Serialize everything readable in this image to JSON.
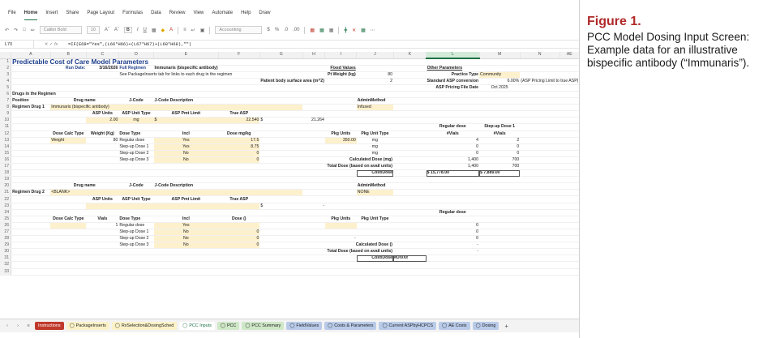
{
  "menu": [
    "File",
    "Home",
    "Insert",
    "Share",
    "Page Layout",
    "Formulas",
    "Data",
    "Review",
    "View",
    "Automate",
    "Help",
    "Draw"
  ],
  "menu_active": 1,
  "toolbar": {
    "font": "Calibri Bold",
    "size": "10",
    "numfmt": "Accounting"
  },
  "namebox": "L70",
  "formula": "=IF(E68=\"Yes\",(L66*H66)+(L67*H67)+(L68*H68),\"\")",
  "columns": [
    "",
    "A",
    "B",
    "C",
    "D",
    "E",
    "F",
    "G",
    "H",
    "I",
    "J",
    "K",
    "L",
    "M",
    "N",
    "AE"
  ],
  "rows": [
    {
      "n": "1",
      "cells": [
        {
          "t": "Predictable Cost of Care Model Parameters",
          "cls": "title",
          "span": 6
        }
      ]
    },
    {
      "n": "2",
      "cells": [
        {
          "t": "Run Date:",
          "col": 1,
          "cls": "blue r"
        },
        {
          "t": "3/16/2026",
          "col": 2,
          "cls": "r b"
        },
        {
          "t": "Full Regimen",
          "col": 3,
          "cls": "blue"
        },
        {
          "t": "Immunaris (bispecific antibody)",
          "col": 4,
          "cls": "b",
          "span": 2
        },
        {
          "t": "Fixed Values",
          "col": 8,
          "cls": "b ul r"
        },
        {
          "t": "Other Parameters",
          "col": 11,
          "cls": "b ul"
        }
      ]
    },
    {
      "n": "3",
      "cells": [
        {
          "t": "See PackageInserts tab for links to each drug in the regimen",
          "col": 3,
          "span": 4
        },
        {
          "t": "Pt Weight (kg)",
          "col": 8,
          "cls": "r b"
        },
        {
          "t": "80",
          "col": 9,
          "cls": "r"
        },
        {
          "t": "Practice Type",
          "col": 11,
          "cls": "r b"
        },
        {
          "t": "Community",
          "col": 12,
          "cls": "yl"
        }
      ]
    },
    {
      "n": "4",
      "cells": [
        {
          "t": "Patient body surface area (m^2)",
          "col": 6,
          "cls": "r b",
          "span": 2
        },
        {
          "t": "2",
          "col": 9,
          "cls": "r"
        },
        {
          "t": "Standard ASP conversion",
          "col": 11,
          "cls": "r b"
        },
        {
          "t": "6.00%",
          "col": 12,
          "cls": "r"
        },
        {
          "t": "(ASP Pricing Limit to true ASP)",
          "col": 13,
          "span": 3
        }
      ]
    },
    {
      "n": "5",
      "cells": [
        {
          "t": "ASP Pricing File Date",
          "col": 11,
          "cls": "r b"
        },
        {
          "t": "Oct 2025",
          "col": 12,
          "cls": "c"
        }
      ]
    },
    {
      "n": "6",
      "cells": [
        {
          "t": "Drugs in the Regimen",
          "col": 0,
          "cls": "b",
          "span": 2
        }
      ]
    },
    {
      "n": "7",
      "cells": [
        {
          "t": "Position",
          "col": 0,
          "cls": "b"
        },
        {
          "t": "Drug name",
          "col": 1,
          "cls": "b c",
          "span": 2
        },
        {
          "t": "J-Code",
          "col": 3,
          "cls": "b c"
        },
        {
          "t": "J-Code Description",
          "col": 4,
          "cls": "b"
        },
        {
          "t": "AdminMethod",
          "col": 9,
          "cls": "b"
        }
      ]
    },
    {
      "n": "8",
      "cells": [
        {
          "t": "Regimen Drug 1",
          "col": 0,
          "cls": "b"
        },
        {
          "t": "Immunaris (bispecific antibody)",
          "col": 1,
          "cls": "yl",
          "span": 2
        },
        {
          "t": "",
          "col": 3,
          "cls": "yl"
        },
        {
          "t": "",
          "col": 4,
          "cls": "yl"
        },
        {
          "t": "",
          "col": 5,
          "cls": "yl"
        },
        {
          "t": "",
          "col": 6,
          "cls": "yl"
        },
        {
          "t": "Infused",
          "col": 9,
          "cls": "yl"
        }
      ]
    },
    {
      "n": "9",
      "cells": [
        {
          "t": "ASP Units",
          "col": 2,
          "cls": "b c"
        },
        {
          "t": "ASP Unit Type",
          "col": 3,
          "cls": "b c"
        },
        {
          "t": "ASP Pmt Limit",
          "col": 4,
          "cls": "b c"
        },
        {
          "t": "True ASP",
          "col": 5,
          "cls": "b c"
        }
      ]
    },
    {
      "n": "10",
      "cells": [
        {
          "t": "2.00",
          "col": 2,
          "cls": "yl r"
        },
        {
          "t": "mg",
          "col": 3,
          "cls": "yl c"
        },
        {
          "t": "$",
          "col": 4,
          "cls": "yl"
        },
        {
          "t": "22.540",
          "col": 5,
          "cls": "yl r"
        },
        {
          "t": "$",
          "col": 6
        },
        {
          "t": "21.264",
          "col": 7,
          "cls": "r"
        }
      ]
    },
    {
      "n": "11",
      "cells": [
        {
          "t": "Regular dose",
          "col": 11,
          "cls": "b c"
        },
        {
          "t": "Step-up Dose 1",
          "col": 12,
          "cls": "b c"
        }
      ]
    },
    {
      "n": "12",
      "cells": [
        {
          "t": "Dose Calc Type",
          "col": 1,
          "cls": "b c"
        },
        {
          "t": "Weight (Kg)",
          "col": 2,
          "cls": "b c"
        },
        {
          "t": "Dose Type",
          "col": 3,
          "cls": "b"
        },
        {
          "t": "Incl",
          "col": 4,
          "cls": "b c"
        },
        {
          "t": "Dose mg/kg",
          "col": 5,
          "cls": "b c"
        },
        {
          "t": "Pkg Units",
          "col": 8,
          "cls": "b c"
        },
        {
          "t": "Pkg Unit Type",
          "col": 9,
          "cls": "b c"
        },
        {
          "t": "#Vials",
          "col": 11,
          "cls": "b c"
        },
        {
          "t": "#Vials",
          "col": 12,
          "cls": "b c"
        }
      ]
    },
    {
      "n": "13",
      "cells": [
        {
          "t": "Weight",
          "col": 1,
          "cls": "yl"
        },
        {
          "t": "80",
          "col": 2,
          "cls": "r"
        },
        {
          "t": "Regular dose",
          "col": 3
        },
        {
          "t": "Yes",
          "col": 4,
          "cls": "yl c"
        },
        {
          "t": "17.5",
          "col": 5,
          "cls": "yl r"
        },
        {
          "t": "350.00",
          "col": 8,
          "cls": "yl r"
        },
        {
          "t": "mg",
          "col": 9,
          "cls": "c"
        },
        {
          "t": "4",
          "col": 11,
          "cls": "r"
        },
        {
          "t": "2",
          "col": 12,
          "cls": "r"
        }
      ]
    },
    {
      "n": "14",
      "cells": [
        {
          "t": "Step-up Dose 1",
          "col": 3
        },
        {
          "t": "Yes",
          "col": 4,
          "cls": "yl c"
        },
        {
          "t": "8.75",
          "col": 5,
          "cls": "yl r"
        },
        {
          "t": "mg",
          "col": 9,
          "cls": "c"
        },
        {
          "t": "0",
          "col": 11,
          "cls": "r"
        },
        {
          "t": "0",
          "col": 12,
          "cls": "r"
        }
      ]
    },
    {
      "n": "15",
      "cells": [
        {
          "t": "Step-up Dose 2",
          "col": 3
        },
        {
          "t": "No",
          "col": 4,
          "cls": "yl c"
        },
        {
          "t": "0",
          "col": 5,
          "cls": "yl r"
        },
        {
          "t": "mg",
          "col": 9,
          "cls": "c"
        },
        {
          "t": "0",
          "col": 11,
          "cls": "r"
        },
        {
          "t": "0",
          "col": 12,
          "cls": "r"
        }
      ]
    },
    {
      "n": "16",
      "cells": [
        {
          "t": "Step-up Dose 3",
          "col": 3
        },
        {
          "t": "No",
          "col": 4,
          "cls": "yl c"
        },
        {
          "t": "0",
          "col": 5,
          "cls": "yl r"
        },
        {
          "t": "Calculated Dose (mg)",
          "col": 8,
          "cls": "b r",
          "span": 2
        },
        {
          "t": "1,400",
          "col": 11,
          "cls": "r"
        },
        {
          "t": "700",
          "col": 12,
          "cls": "r"
        }
      ]
    },
    {
      "n": "17",
      "cells": [
        {
          "t": "Total Dose (based on avail units)",
          "col": 7,
          "cls": "b r",
          "span": 3
        },
        {
          "t": "1,400",
          "col": 11,
          "cls": "r"
        },
        {
          "t": "700",
          "col": 12,
          "cls": "r"
        }
      ]
    },
    {
      "n": "18",
      "cells": [
        {
          "t": "Cost/Dose",
          "col": 9,
          "cls": "b r bx"
        },
        {
          "t": "$  15,778.00",
          "col": 11,
          "cls": "b bx"
        },
        {
          "t": "$    7,889.00",
          "col": 12,
          "cls": "b bx"
        }
      ]
    },
    {
      "n": "19",
      "cells": []
    },
    {
      "n": "20",
      "cells": [
        {
          "t": "Drug name",
          "col": 1,
          "cls": "b c",
          "span": 2
        },
        {
          "t": "J-Code",
          "col": 3,
          "cls": "b c"
        },
        {
          "t": "J-Code Description",
          "col": 4,
          "cls": "b"
        },
        {
          "t": "AdminMethod",
          "col": 9,
          "cls": "b"
        }
      ]
    },
    {
      "n": "21",
      "cells": [
        {
          "t": "Regimen Drug 2",
          "col": 0,
          "cls": "b"
        },
        {
          "t": "<BLANK>",
          "col": 1,
          "cls": "yl",
          "span": 2
        },
        {
          "t": "",
          "col": 3,
          "cls": "yl"
        },
        {
          "t": "",
          "col": 4,
          "cls": "yl"
        },
        {
          "t": "",
          "col": 5,
          "cls": "yl"
        },
        {
          "t": "",
          "col": 6,
          "cls": "yl"
        },
        {
          "t": "NONE",
          "col": 9,
          "cls": "yl"
        }
      ]
    },
    {
      "n": "22",
      "cells": [
        {
          "t": "ASP Units",
          "col": 2,
          "cls": "b c"
        },
        {
          "t": "ASP Unit Type",
          "col": 3,
          "cls": "b c"
        },
        {
          "t": "ASP Pmt Limit",
          "col": 4,
          "cls": "b c"
        },
        {
          "t": "True ASP",
          "col": 5,
          "cls": "b c"
        }
      ]
    },
    {
      "n": "23",
      "cells": [
        {
          "t": "",
          "col": 2,
          "cls": "yl"
        },
        {
          "t": "",
          "col": 3,
          "cls": "yl"
        },
        {
          "t": "",
          "col": 4,
          "cls": "yl"
        },
        {
          "t": "",
          "col": 5,
          "cls": "yl"
        },
        {
          "t": "$",
          "col": 6
        },
        {
          "t": "-",
          "col": 7,
          "cls": "r"
        }
      ]
    },
    {
      "n": "24",
      "cells": [
        {
          "t": "Regular dose",
          "col": 11,
          "cls": "b c"
        }
      ]
    },
    {
      "n": "25",
      "cells": [
        {
          "t": "Dose Calc Type",
          "col": 1,
          "cls": "b c"
        },
        {
          "t": "Vials",
          "col": 2,
          "cls": "b c"
        },
        {
          "t": "Dose Type",
          "col": 3,
          "cls": "b"
        },
        {
          "t": "Incl",
          "col": 4,
          "cls": "b c"
        },
        {
          "t": "Dose ()",
          "col": 5,
          "cls": "b c"
        },
        {
          "t": "Pkg Units",
          "col": 8,
          "cls": "b c"
        },
        {
          "t": "Pkg Unit Type",
          "col": 9,
          "cls": "b c"
        }
      ]
    },
    {
      "n": "26",
      "cells": [
        {
          "t": "",
          "col": 1,
          "cls": "yl"
        },
        {
          "t": "1",
          "col": 2,
          "cls": "r"
        },
        {
          "t": "Regular dose",
          "col": 3
        },
        {
          "t": "Yes",
          "col": 4,
          "cls": "yl c"
        },
        {
          "t": "",
          "col": 5,
          "cls": "yl"
        },
        {
          "t": "",
          "col": 8,
          "cls": "yl"
        },
        {
          "t": "",
          "col": 9
        },
        {
          "t": "0",
          "col": 11,
          "cls": "r"
        }
      ]
    },
    {
      "n": "27",
      "cells": [
        {
          "t": "Step-up Dose 1",
          "col": 3
        },
        {
          "t": "No",
          "col": 4,
          "cls": "yl c"
        },
        {
          "t": "0",
          "col": 5,
          "cls": "yl r"
        },
        {
          "t": "0",
          "col": 11,
          "cls": "r"
        }
      ]
    },
    {
      "n": "28",
      "cells": [
        {
          "t": "Step-up Dose 2",
          "col": 3
        },
        {
          "t": "No",
          "col": 4,
          "cls": "yl c"
        },
        {
          "t": "0",
          "col": 5,
          "cls": "yl r"
        },
        {
          "t": "-",
          "col": 8,
          "cls": "r"
        },
        {
          "t": "0",
          "col": 11,
          "cls": "r"
        }
      ]
    },
    {
      "n": "29",
      "cells": [
        {
          "t": "Step-up Dose 3",
          "col": 3
        },
        {
          "t": "No",
          "col": 4,
          "cls": "yl c"
        },
        {
          "t": "0",
          "col": 5,
          "cls": "yl r"
        },
        {
          "t": "Calculated Dose ()",
          "col": 8,
          "cls": "b r",
          "span": 2
        },
        {
          "t": "-",
          "col": 11,
          "cls": "r"
        }
      ]
    },
    {
      "n": "30",
      "cells": [
        {
          "t": "Total Dose (based on avail units)",
          "col": 7,
          "cls": "b r",
          "span": 3
        },
        {
          "t": "-",
          "col": 11,
          "cls": "r"
        }
      ]
    },
    {
      "n": "31",
      "cells": [
        {
          "t": "Cost/Dose",
          "col": 9,
          "cls": "b r bx"
        },
        {
          "t": "#DIV/0!",
          "col": 10,
          "cls": "b bx"
        }
      ]
    },
    {
      "n": "32",
      "cells": []
    },
    {
      "n": "33",
      "cells": []
    }
  ],
  "tabs": [
    {
      "label": "Instructions",
      "bg": "#c0392b",
      "fg": "#fff",
      "icon": ""
    },
    {
      "label": "PackageInserts",
      "bg": "#fbf2c8",
      "fg": "#222",
      "icon": "◯"
    },
    {
      "label": "RxSelection&DosingSched",
      "bg": "#fbf2c8",
      "fg": "#222",
      "icon": "◯"
    },
    {
      "label": "PCC Inputs",
      "bg": "#fff",
      "fg": "#1e7145",
      "icon": "◯"
    },
    {
      "label": "PCC",
      "bg": "#cfe8c7",
      "fg": "#222",
      "icon": "◯"
    },
    {
      "label": "PCC Summary",
      "bg": "#cfe8c7",
      "fg": "#222",
      "icon": "◯"
    },
    {
      "label": "FieldValues",
      "bg": "#b9cbe9",
      "fg": "#222",
      "icon": "◯"
    },
    {
      "label": "Costs & Parameters",
      "bg": "#b9cbe9",
      "fg": "#222",
      "icon": "◯"
    },
    {
      "label": "Current ASPbyHCPCS",
      "bg": "#b9cbe9",
      "fg": "#222",
      "icon": "◯"
    },
    {
      "label": "AE Costs",
      "bg": "#b9cbe9",
      "fg": "#222",
      "icon": "◯"
    },
    {
      "label": "Dosing",
      "bg": "#b9cbe9",
      "fg": "#222",
      "icon": "◯"
    }
  ],
  "caption": {
    "title": "Figure 1.",
    "body": "PCC Model Dosing Input Screen: Example data for an illustrative bispecific antibody (“Immunaris”)."
  }
}
